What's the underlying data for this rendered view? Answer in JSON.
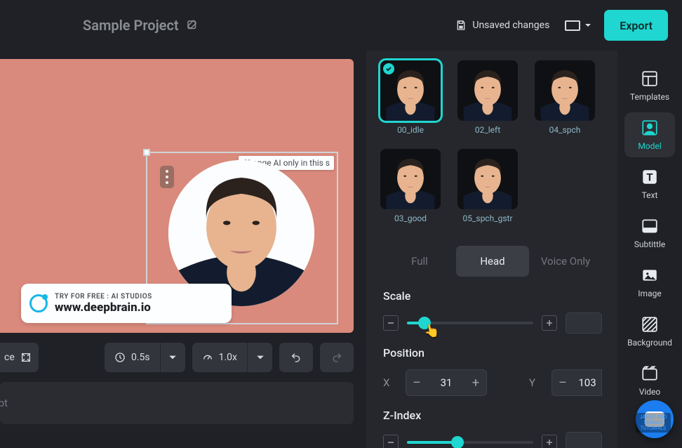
{
  "header": {
    "project_title": "Sample Project",
    "unsaved_label": "Unsaved changes",
    "export_label": "Export"
  },
  "canvas": {
    "tooltip": "Change AI only in this s",
    "promo_tag": "TRY FOR FREE : AI STUDIOS",
    "promo_url": "www.deepbrain.io"
  },
  "toolbar": {
    "left_partial": "ce",
    "duration_value": "0.5s",
    "speed_value": "1.0x",
    "script_placeholder": "ipt"
  },
  "models": {
    "items": [
      {
        "label": "00_idle",
        "selected": true
      },
      {
        "label": "02_left",
        "selected": false
      },
      {
        "label": "04_spch",
        "selected": false
      },
      {
        "label": "03_good",
        "selected": false
      },
      {
        "label": "05_spch_gstr",
        "selected": false
      }
    ]
  },
  "mode_tabs": {
    "options": [
      "Full",
      "Head",
      "Voice Only"
    ],
    "active": "Head"
  },
  "props": {
    "scale": {
      "label": "Scale",
      "fill_pct": 14
    },
    "position": {
      "label": "Position",
      "x_label": "X",
      "x_value": "31",
      "y_label": "Y",
      "y_value": "103"
    },
    "zindex": {
      "label": "Z-Index",
      "fill_pct": 40
    }
  },
  "rail": {
    "items": [
      {
        "key": "templates",
        "label": "Templates"
      },
      {
        "key": "model",
        "label": "Model"
      },
      {
        "key": "text",
        "label": "Text"
      },
      {
        "key": "subtitle",
        "label": "Subtittle"
      },
      {
        "key": "image",
        "label": "Image"
      },
      {
        "key": "background",
        "label": "Background"
      },
      {
        "key": "video",
        "label": "Video"
      }
    ],
    "active": "model",
    "badge": "JAMES AND SERNA'S TUTORIALS"
  },
  "colors": {
    "accent": "#1fd6d0"
  }
}
